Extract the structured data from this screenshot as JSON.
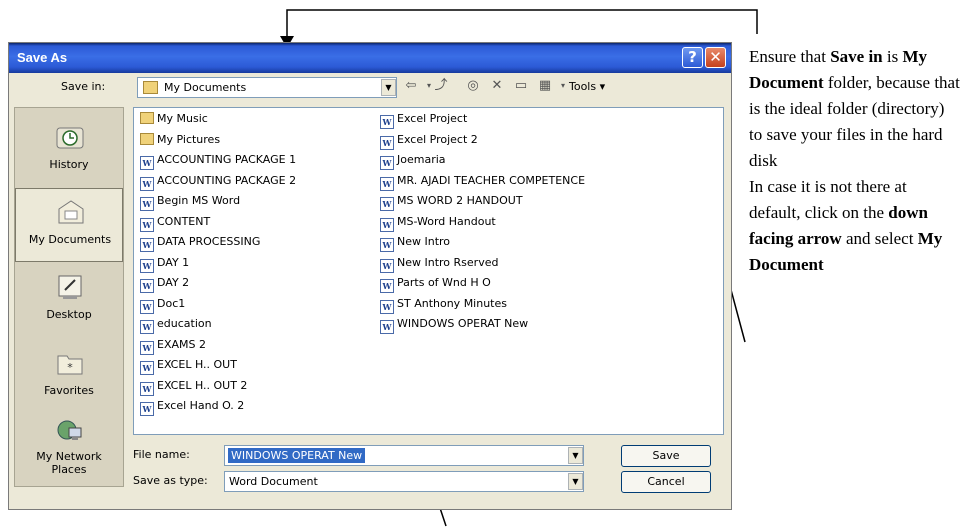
{
  "dialog": {
    "title": "Save As",
    "help_label": "?",
    "close_label": "✕",
    "save_in_label": "Save in:",
    "save_in_value": "My Documents",
    "tools_label": "Tools",
    "file_name_label": "File name:",
    "file_name_value": "WINDOWS OPERAT New",
    "save_as_type_label": "Save as type:",
    "save_as_type_value": "Word Document",
    "save_button": "Save",
    "cancel_button": "Cancel"
  },
  "places": [
    {
      "label": "History",
      "icon": "history-icon"
    },
    {
      "label": "My Documents",
      "icon": "my-documents-icon"
    },
    {
      "label": "Desktop",
      "icon": "desktop-icon"
    },
    {
      "label": "Favorites",
      "icon": "favorites-icon"
    },
    {
      "label": "My Network Places",
      "icon": "network-icon"
    }
  ],
  "files_col1": [
    {
      "name": "My Music",
      "type": "folder"
    },
    {
      "name": "My Pictures",
      "type": "folder"
    },
    {
      "name": "ACCOUNTING PACKAGE 1",
      "type": "doc"
    },
    {
      "name": "ACCOUNTING PACKAGE 2",
      "type": "doc"
    },
    {
      "name": "Begin MS Word",
      "type": "doc"
    },
    {
      "name": "CONTENT",
      "type": "doc"
    },
    {
      "name": "DATA PROCESSING",
      "type": "doc"
    },
    {
      "name": "DAY 1",
      "type": "doc"
    },
    {
      "name": "DAY 2",
      "type": "doc"
    },
    {
      "name": "Doc1",
      "type": "doc"
    },
    {
      "name": "education",
      "type": "doc"
    },
    {
      "name": "EXAMS 2",
      "type": "doc"
    },
    {
      "name": "EXCEL H.. OUT",
      "type": "doc"
    },
    {
      "name": "EXCEL H.. OUT 2",
      "type": "doc"
    },
    {
      "name": "Excel Hand O. 2",
      "type": "doc"
    }
  ],
  "files_col2": [
    {
      "name": "Excel Project",
      "type": "doc"
    },
    {
      "name": "Excel Project 2",
      "type": "doc"
    },
    {
      "name": "Joemaria",
      "type": "doc"
    },
    {
      "name": "MR. AJADI TEACHER COMPETENCE",
      "type": "doc"
    },
    {
      "name": "MS WORD 2 HANDOUT",
      "type": "doc"
    },
    {
      "name": "MS-Word Handout",
      "type": "doc"
    },
    {
      "name": "New Intro",
      "type": "doc"
    },
    {
      "name": "New Intro Rserved",
      "type": "doc"
    },
    {
      "name": "Parts of Wnd H O",
      "type": "doc"
    },
    {
      "name": "ST Anthony Minutes",
      "type": "doc"
    },
    {
      "name": "WINDOWS OPERAT New",
      "type": "doc"
    }
  ],
  "annotation": {
    "t1": "Ensure that ",
    "b1": "Save in",
    "t2": " is ",
    "b2": "My Document",
    "t3": " folder, because that is the ideal folder (directory) to save your files in the hard disk",
    "t4": "In case it is not there at default, click on the ",
    "b3": "down facing arrow",
    "t5": " and select ",
    "b4": "My Document"
  }
}
